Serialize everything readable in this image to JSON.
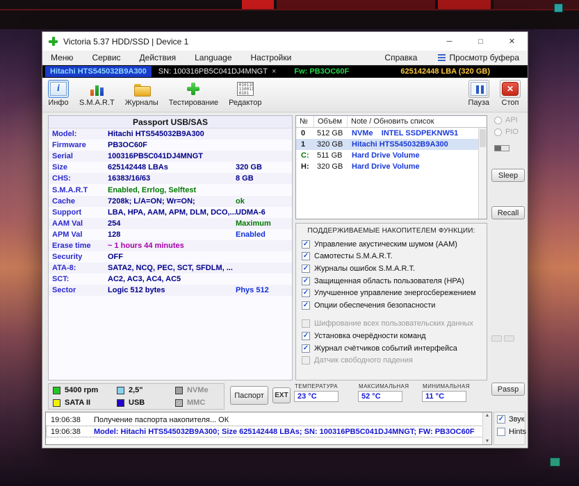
{
  "window": {
    "title": "Victoria 5.37 HDD/SSD | Device 1"
  },
  "window_controls": {
    "minimize": "─",
    "maximize": "□",
    "close": "✕"
  },
  "menu": {
    "items": [
      "Меню",
      "Сервис",
      "Действия",
      "Language",
      "Настройки",
      "Справка"
    ],
    "buffer_view": "Просмотр буфера"
  },
  "device_bar": {
    "model": "Hitachi HTS545032B9A300",
    "serial": "SN: 100316PB5C041DJ4MNGT",
    "close_chip": "×",
    "firmware": "Fw: PB3OC60F",
    "capacity": "625142448 LBA (320 GB)"
  },
  "toolbar": {
    "buttons": [
      {
        "id": "info",
        "label": "Инфо",
        "icon": "info-icon",
        "active": true
      },
      {
        "id": "smart",
        "label": "S.M.A.R.T",
        "icon": "smart-icon",
        "active": false
      },
      {
        "id": "journals",
        "label": "Журналы",
        "icon": "journals-icon",
        "active": false
      },
      {
        "id": "testing",
        "label": "Тестирование",
        "icon": "test-icon",
        "active": false
      },
      {
        "id": "editor",
        "label": "Редактор",
        "icon": "editor-icon",
        "active": false
      }
    ],
    "pause_label": "Пауза",
    "stop_label": "Стоп"
  },
  "palette": {
    "navy": "#00008b",
    "blue": "#1030d8",
    "green": "#007a00",
    "magenta": "#a800a8",
    "black": "#1a1a1a",
    "gray": "#9a9a9a"
  },
  "passport": {
    "title": "Passport USB/SAS",
    "rows": [
      {
        "label": "Model:",
        "value": "Hitachi HTS545032B9A300",
        "vc": "navy",
        "extra": "",
        "ec": "navy"
      },
      {
        "label": "Firmware",
        "value": "PB3OC60F",
        "vc": "navy",
        "extra": "",
        "ec": "navy"
      },
      {
        "label": "Serial",
        "value": "100316PB5C041DJ4MNGT",
        "vc": "navy",
        "extra": "",
        "ec": "navy"
      },
      {
        "label": "Size",
        "value": "625142448 LBAs",
        "vc": "navy",
        "extra": "320 GB",
        "ec": "navy"
      },
      {
        "label": "CHS:",
        "value": "16383/16/63",
        "vc": "navy",
        "extra": "8 GB",
        "ec": "navy"
      },
      {
        "label": "S.M.A.R.T",
        "value": "Enabled, Errlog, Selftest",
        "vc": "green",
        "extra": "",
        "ec": "navy"
      },
      {
        "label": "Cache",
        "value": "7208k; L/A=ON; Wr=ON;",
        "vc": "navy",
        "extra": "ok",
        "ec": "green"
      },
      {
        "label": "Support",
        "value": "LBA, HPA, AAM, APM, DLM, DCO,...",
        "vc": "navy",
        "extra": "UDMA-6",
        "ec": "navy"
      },
      {
        "label": "AAM Val",
        "value": "254",
        "vc": "navy",
        "extra": "Maximum",
        "ec": "green"
      },
      {
        "label": "APM Val",
        "value": "128",
        "vc": "navy",
        "extra": "Enabled",
        "ec": "blue"
      },
      {
        "label": "Erase time",
        "value": "~ 1 hours 44 minutes",
        "vc": "magenta",
        "extra": "",
        "ec": "navy"
      },
      {
        "label": "Security",
        "value": "OFF",
        "vc": "navy",
        "extra": "",
        "ec": "navy"
      },
      {
        "label": "ATA-8:",
        "value": "SATA2, NCQ, PEC, SCT, SFDLM, ...",
        "vc": "navy",
        "extra": "",
        "ec": "navy"
      },
      {
        "label": "SCT:",
        "value": "AC2, AC3, AC4, AC5",
        "vc": "navy",
        "extra": "",
        "ec": "navy"
      },
      {
        "label": "Sector",
        "value": "Logic 512 bytes",
        "vc": "navy",
        "extra": "Phys 512",
        "ec": "blue"
      }
    ]
  },
  "drive_list": {
    "headers": [
      "№",
      "Объём",
      "Note / Обновить список"
    ],
    "rows": [
      {
        "num": "0",
        "num_color": "black",
        "size": "512 GB",
        "note": "NVMe    INTEL SSDPEKNW51",
        "selected": false
      },
      {
        "num": "1",
        "num_color": "black",
        "size": "320 GB",
        "note": "Hitachi HTS545032B9A300",
        "selected": true
      },
      {
        "num": "C:",
        "num_color": "green",
        "size": "511 GB",
        "note": "Hard Drive Volume",
        "selected": false
      },
      {
        "num": "H:",
        "num_color": "black",
        "size": "320 GB",
        "note": "Hard Drive Volume",
        "selected": false
      }
    ]
  },
  "side_controls": {
    "api": "API",
    "pio": "PIO",
    "sleep": "Sleep",
    "recall": "Recall",
    "passp": "Passp"
  },
  "functions": {
    "title": "ПОДДЕРЖИВАЕМЫЕ НАКОПИТЕЛЕМ ФУНКЦИИ:",
    "items": [
      {
        "label": "Управление акустическим шумом (AAM)",
        "checked": true,
        "enabled": true
      },
      {
        "label": "Самотесты S.M.A.R.T.",
        "checked": true,
        "enabled": true
      },
      {
        "label": "Журналы ошибок S.M.A.R.T.",
        "checked": true,
        "enabled": true
      },
      {
        "label": "Защищенная область пользователя (HPA)",
        "checked": true,
        "enabled": true
      },
      {
        "label": "Улучшенное управление энергосбережением",
        "checked": true,
        "enabled": true
      },
      {
        "label": "Опции обеспечения безопасности",
        "checked": true,
        "enabled": true
      },
      {
        "label": "Шифрование всех пользовательских данных",
        "checked": false,
        "enabled": false
      },
      {
        "label": "Установка очерёдности команд",
        "checked": true,
        "enabled": true
      },
      {
        "label": "Журнал счётчиков событий интерфейса",
        "checked": true,
        "enabled": true
      },
      {
        "label": "Датчик свободного падения",
        "checked": false,
        "enabled": false
      }
    ]
  },
  "legend": {
    "items": [
      {
        "label": "5400 rpm",
        "color": "#22c822",
        "text_color": "black"
      },
      {
        "label": "2,5\"",
        "color": "#86d2ee",
        "text_color": "black"
      },
      {
        "label": "NVMe",
        "color": "#a0a0a0",
        "text_color": "gray"
      },
      {
        "label": "SATA II",
        "color": "#f2f200",
        "text_color": "black"
      },
      {
        "label": "USB",
        "color": "#2404cc",
        "text_color": "black"
      },
      {
        "label": "MMC",
        "color": "#b4b4b4",
        "text_color": "gray"
      }
    ],
    "passport_button": "Паспорт",
    "ext_button": "EXT"
  },
  "temperature": {
    "current_label": "ТЕМПЕРАТУРА",
    "current": "23 °C",
    "max_label": "МАКСИМАЛЬНАЯ",
    "max": "52 °C",
    "min_label": "МИНИМАЛЬНАЯ",
    "min": "11 °C"
  },
  "log": {
    "entries": [
      {
        "time": "19:06:38",
        "text": "Получение паспорта накопителя... ОК",
        "color": "black"
      },
      {
        "time": "19:06:38",
        "text": "Model: Hitachi HTS545032B9A300; Size 625142448 LBAs; SN: 100316PB5C041DJ4MNGT; FW: PB3OC60F",
        "color": "blue"
      }
    ]
  },
  "bottom_right": {
    "sound": "Звук",
    "hints": "Hints"
  }
}
